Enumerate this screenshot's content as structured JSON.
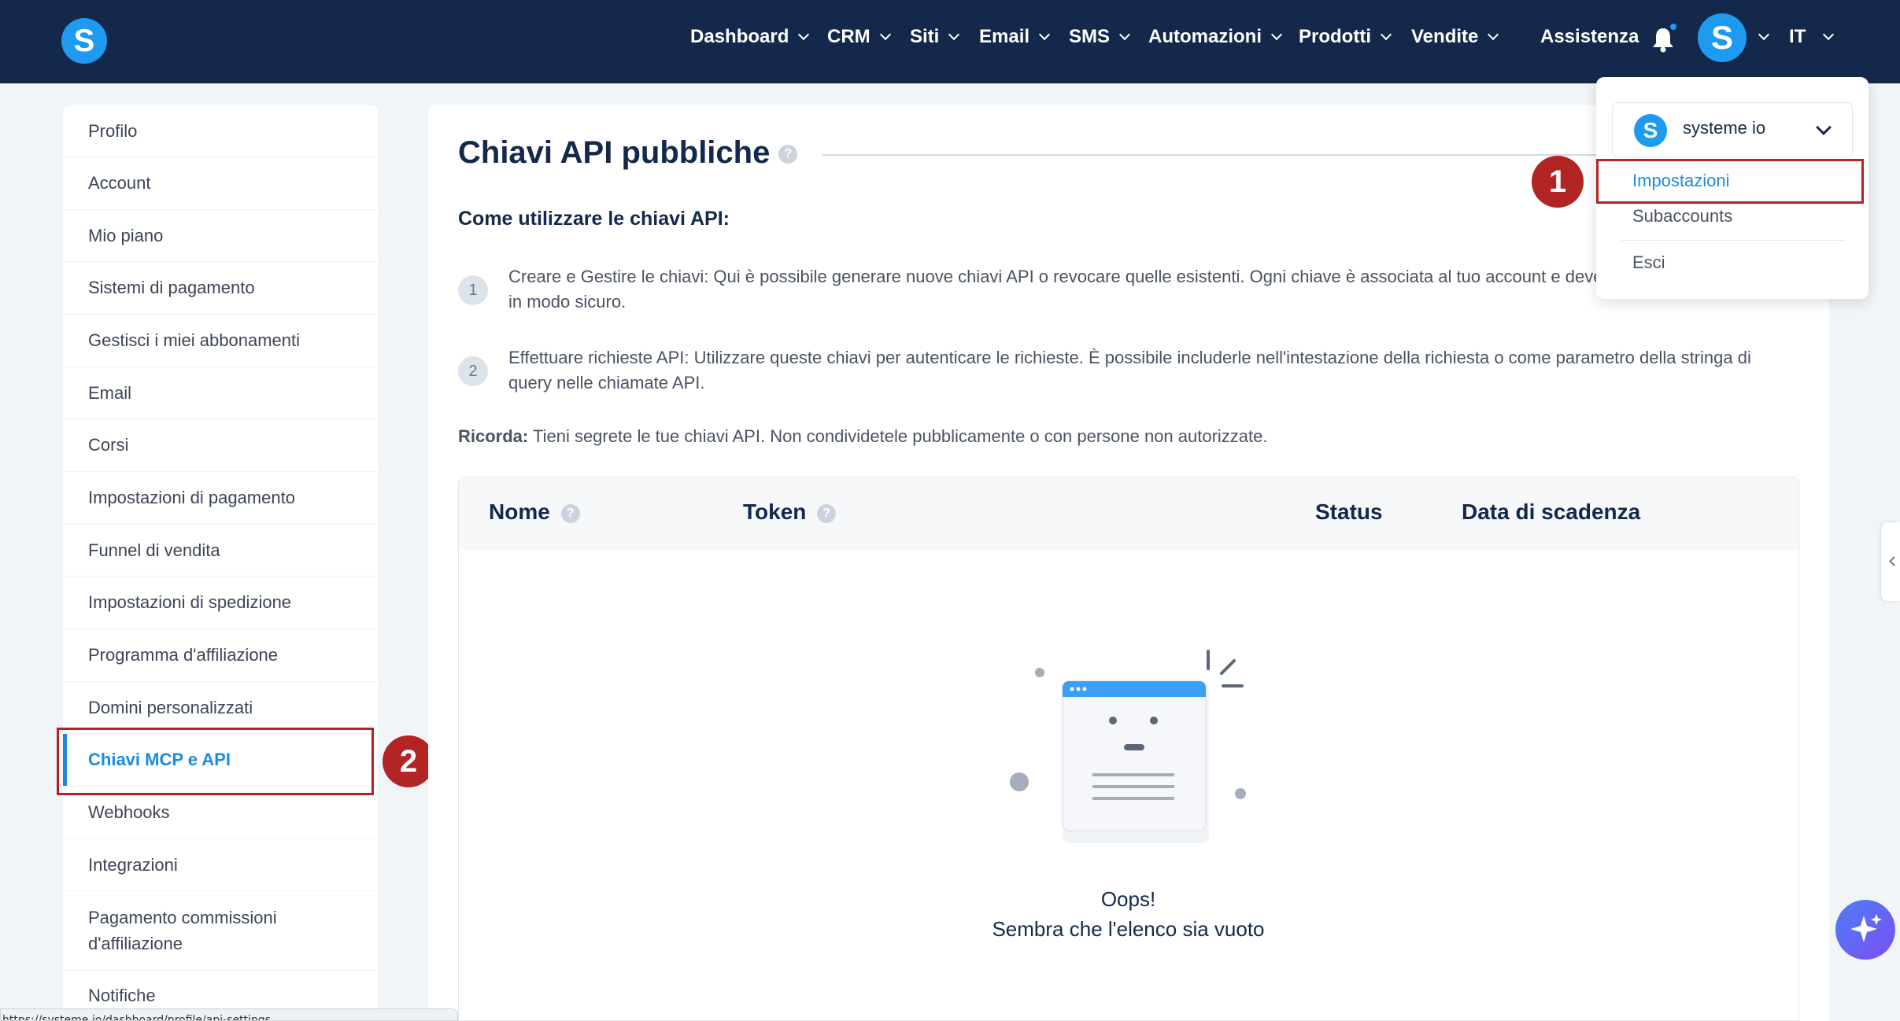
{
  "header": {
    "logo_letter": "S",
    "nav": [
      {
        "label": "Dashboard"
      },
      {
        "label": "CRM"
      },
      {
        "label": "Siti"
      },
      {
        "label": "Email"
      },
      {
        "label": "SMS"
      },
      {
        "label": "Automazioni"
      },
      {
        "label": "Prodotti"
      },
      {
        "label": "Vendite"
      }
    ],
    "help_label": "Assistenza",
    "avatar_letter": "S",
    "language": "IT"
  },
  "sidebar": {
    "items": [
      {
        "label": "Profilo"
      },
      {
        "label": "Account"
      },
      {
        "label": "Mio piano"
      },
      {
        "label": "Sistemi di pagamento"
      },
      {
        "label": "Gestisci i miei abbonamenti"
      },
      {
        "label": "Email"
      },
      {
        "label": "Corsi"
      },
      {
        "label": "Impostazioni di pagamento"
      },
      {
        "label": "Funnel di vendita"
      },
      {
        "label": "Impostazioni di spedizione"
      },
      {
        "label": "Programma d'affiliazione"
      },
      {
        "label": "Domini personalizzati"
      },
      {
        "label": "Chiavi MCP e API"
      },
      {
        "label": "Webhooks"
      },
      {
        "label": "Integrazioni"
      },
      {
        "label": "Pagamento commissioni d'affiliazione"
      },
      {
        "label": "Notifiche"
      }
    ],
    "active_index": 12
  },
  "main": {
    "title": "Chiavi API pubbliche",
    "help_icon": "?",
    "subheading": "Come utilizzare le chiavi API:",
    "steps": [
      {
        "num": "1",
        "text": "Creare e Gestire le chiavi: Qui è possibile generare nuove chiavi API o revocare quelle esistenti. Ogni chiave è associata al tuo account e deve essere conservata in modo sicuro."
      },
      {
        "num": "2",
        "text": "Effettuare richieste API: Utilizzare queste chiavi per autenticare le richieste. È possibile includerle nell'intestazione della richiesta o come parametro della stringa di query nelle chiamate API."
      }
    ],
    "reminder_label": "Ricorda:",
    "reminder_text": " Tieni segrete le tue chiavi API. Non condividetele pubblicamente o con persone non autorizzate.",
    "table": {
      "columns": [
        "Nome",
        "Token",
        "Status",
        "Data di scadenza"
      ],
      "empty_title": "Oops!",
      "empty_subtitle": "Sembra che l'elenco sia vuoto"
    }
  },
  "dropdown": {
    "account_logo": "S",
    "account_name": "systeme io",
    "items": [
      {
        "label": "Impostazioni"
      },
      {
        "label": "Subaccounts"
      },
      {
        "label": "Esci"
      }
    ]
  },
  "annotations": {
    "badge_1": "1",
    "badge_2": "2"
  },
  "status_bar": {
    "url": "https://systeme.io/dashboard/profile/api-settings"
  },
  "colors": {
    "topbar": "#14284b",
    "brand_blue": "#1e9bf0",
    "active_link": "#1a8be3",
    "annotation_red": "#b32424"
  }
}
